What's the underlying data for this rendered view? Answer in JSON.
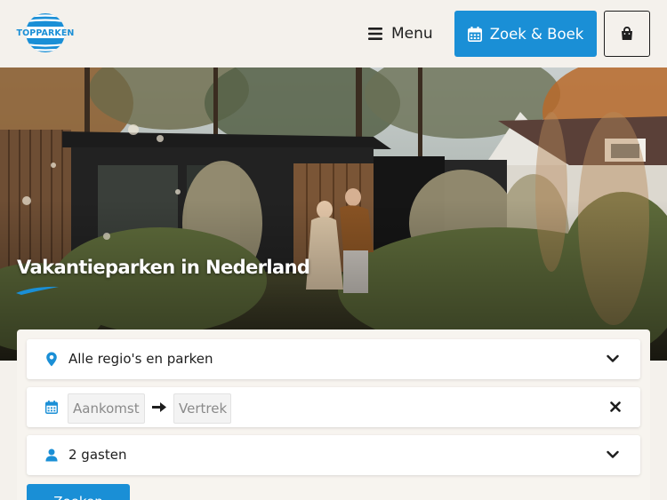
{
  "header": {
    "logo_text": "TOPPARKEN",
    "menu_label": "Menu",
    "book_label": "Zoek & Boek",
    "icons": {
      "menu": "hamburger-icon",
      "book": "calendar-icon",
      "cart": "shopping-bag-icon"
    }
  },
  "hero": {
    "title": "Vakantieparken in Nederland"
  },
  "search": {
    "region_value": "Alle regio's en parken",
    "arrival_placeholder": "Aankomst",
    "departure_placeholder": "Vertrek",
    "guests_value": "2 gasten",
    "submit_label": "Zoeken"
  },
  "colors": {
    "brand": "#1a8fd6",
    "background": "#f4f1ec",
    "text": "#1e1e1e"
  }
}
